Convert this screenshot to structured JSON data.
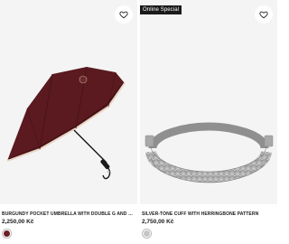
{
  "products": [
    {
      "title": "BURGUNDY POCKET UMBRELLA WITH DOUBLE G AND SIGNATURE ST...",
      "price": "2,250,00 Kč",
      "badge": "",
      "swatch_color": "#6b1e24",
      "icon": "umbrella-product-image"
    },
    {
      "title": "SILVER-TONE CUFF WITH HERRINGBONE PATTERN",
      "price": "2,750,00 Kč",
      "badge": "Online Special",
      "swatch_color": "#c4c4c4",
      "icon": "bracelet-product-image"
    }
  ],
  "colors": {
    "image_bg": "#f4f4f4",
    "badge_bg": "#1a1a1a",
    "umbrella": "#5a1a1f"
  }
}
